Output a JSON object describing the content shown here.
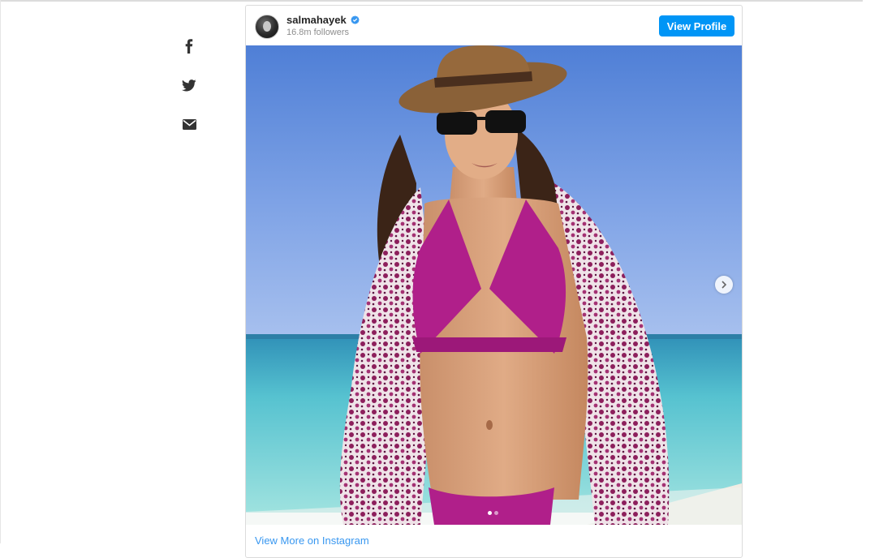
{
  "share": {
    "items": [
      {
        "icon": "facebook-icon"
      },
      {
        "icon": "twitter-icon"
      },
      {
        "icon": "mail-icon"
      }
    ]
  },
  "embed": {
    "username": "salmahayek",
    "followers": "16.8m followers",
    "view_profile_label": "View Profile",
    "view_more_label": "View More on Instagram",
    "carousel": {
      "current_slide": 1,
      "total_slides": 2
    }
  },
  "colors": {
    "accent": "#0095f6",
    "link": "#3897f0",
    "verified": "#3897f0"
  }
}
